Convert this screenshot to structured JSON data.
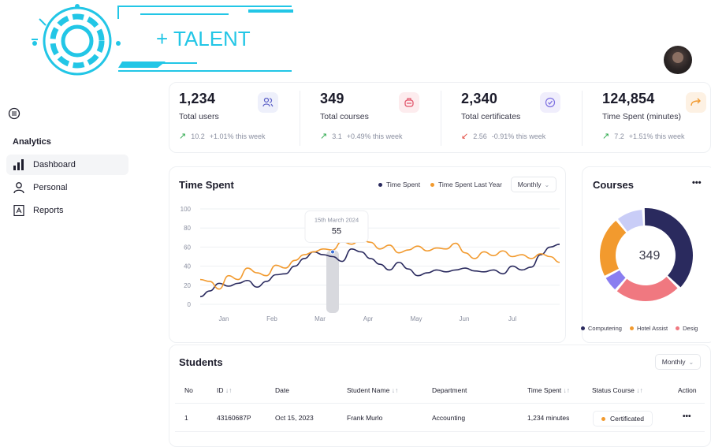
{
  "brand": {
    "name": "+ TALENT",
    "accent": "#22c6e6"
  },
  "sidebar": {
    "section": "Analytics",
    "items": [
      {
        "label": "Dashboard",
        "icon": "bar-chart-icon",
        "active": true
      },
      {
        "label": "Personal",
        "icon": "user-icon",
        "active": false
      },
      {
        "label": "Reports",
        "icon": "pdf-file-icon",
        "active": false
      }
    ]
  },
  "stats": [
    {
      "value": "1,234",
      "label": "Total users",
      "delta": "10.2",
      "change": "+1.01% this week",
      "direction": "up",
      "icon": "users-icon",
      "color": "#5b5fc7"
    },
    {
      "value": "349",
      "label": "Total courses",
      "delta": "3.1",
      "change": "+0.49% this week",
      "direction": "up",
      "icon": "course-icon",
      "color": "#e2556b"
    },
    {
      "value": "2,340",
      "label": "Total certificates",
      "delta": "2.56",
      "change": "-0.91% this week",
      "direction": "down",
      "icon": "check-badge-icon",
      "color": "#7b6ee0"
    },
    {
      "value": "124,854",
      "label": "Time Spent (minutes)",
      "delta": "7.2",
      "change": "+1.51% this week",
      "direction": "up",
      "icon": "share-arrow-icon",
      "color": "#f29a2e"
    }
  ],
  "time_chart": {
    "title": "Time Spent",
    "legend": [
      "Time Spent",
      "Time Spent Last Year"
    ],
    "period": "Monthly",
    "tooltip": {
      "date": "15th March 2024",
      "value": "55"
    }
  },
  "chart_data": {
    "type": "line",
    "x": [
      "Jan",
      "Feb",
      "Mar",
      "Apr",
      "May",
      "Jun",
      "Jul"
    ],
    "ylim": [
      0,
      100
    ],
    "yticks": [
      0,
      20,
      40,
      60,
      80,
      100
    ],
    "series": [
      {
        "name": "Time Spent",
        "color": "#2a2a5e",
        "values": [
          8,
          14,
          22,
          19,
          22,
          25,
          18,
          24,
          31,
          32,
          40,
          48,
          55,
          52,
          50,
          45,
          58,
          55,
          48,
          42,
          36,
          44,
          37,
          30,
          33,
          36,
          34,
          36,
          38,
          35,
          34,
          36,
          32,
          40,
          36,
          39,
          52,
          60,
          63
        ]
      },
      {
        "name": "Time Spent Last Year",
        "color": "#f29a2e",
        "values": [
          26,
          24,
          16,
          30,
          26,
          38,
          33,
          30,
          41,
          38,
          46,
          52,
          55,
          58,
          57,
          66,
          63,
          68,
          65,
          58,
          62,
          54,
          57,
          61,
          56,
          59,
          58,
          64,
          54,
          48,
          55,
          51,
          56,
          50,
          52,
          48,
          53,
          50,
          44
        ]
      }
    ]
  },
  "courses": {
    "title": "Courses",
    "total": "349",
    "menu": "•••",
    "legend": [
      {
        "name": "Computering",
        "color": "#2a2a5e"
      },
      {
        "name": "Hotel Assist",
        "color": "#f29a2e"
      },
      {
        "name": "Desig",
        "color": "#f07880"
      }
    ],
    "segments": [
      {
        "name": "Computering",
        "value": 38,
        "color": "#2a2a5e"
      },
      {
        "name": "Desig",
        "value": 24,
        "color": "#f07880"
      },
      {
        "name": "purple",
        "value": 6,
        "color": "#8a7ef0"
      },
      {
        "name": "Hotel Assist",
        "value": 22,
        "color": "#f29a2e"
      },
      {
        "name": "light",
        "value": 10,
        "color": "#c9cdf7"
      }
    ]
  },
  "students": {
    "title": "Students",
    "period": "Monthly",
    "columns": [
      "No",
      "ID",
      "Date",
      "Student Name",
      "Department",
      "Time Spent",
      "Status Course",
      "Action"
    ],
    "rows": [
      {
        "no": "1",
        "id": "43160687P",
        "date": "Oct 15, 2023",
        "name": "Frank Murlo",
        "department": "Accounting",
        "time": "1,234 minutes",
        "status": "Certificated",
        "action": "•••"
      }
    ]
  }
}
